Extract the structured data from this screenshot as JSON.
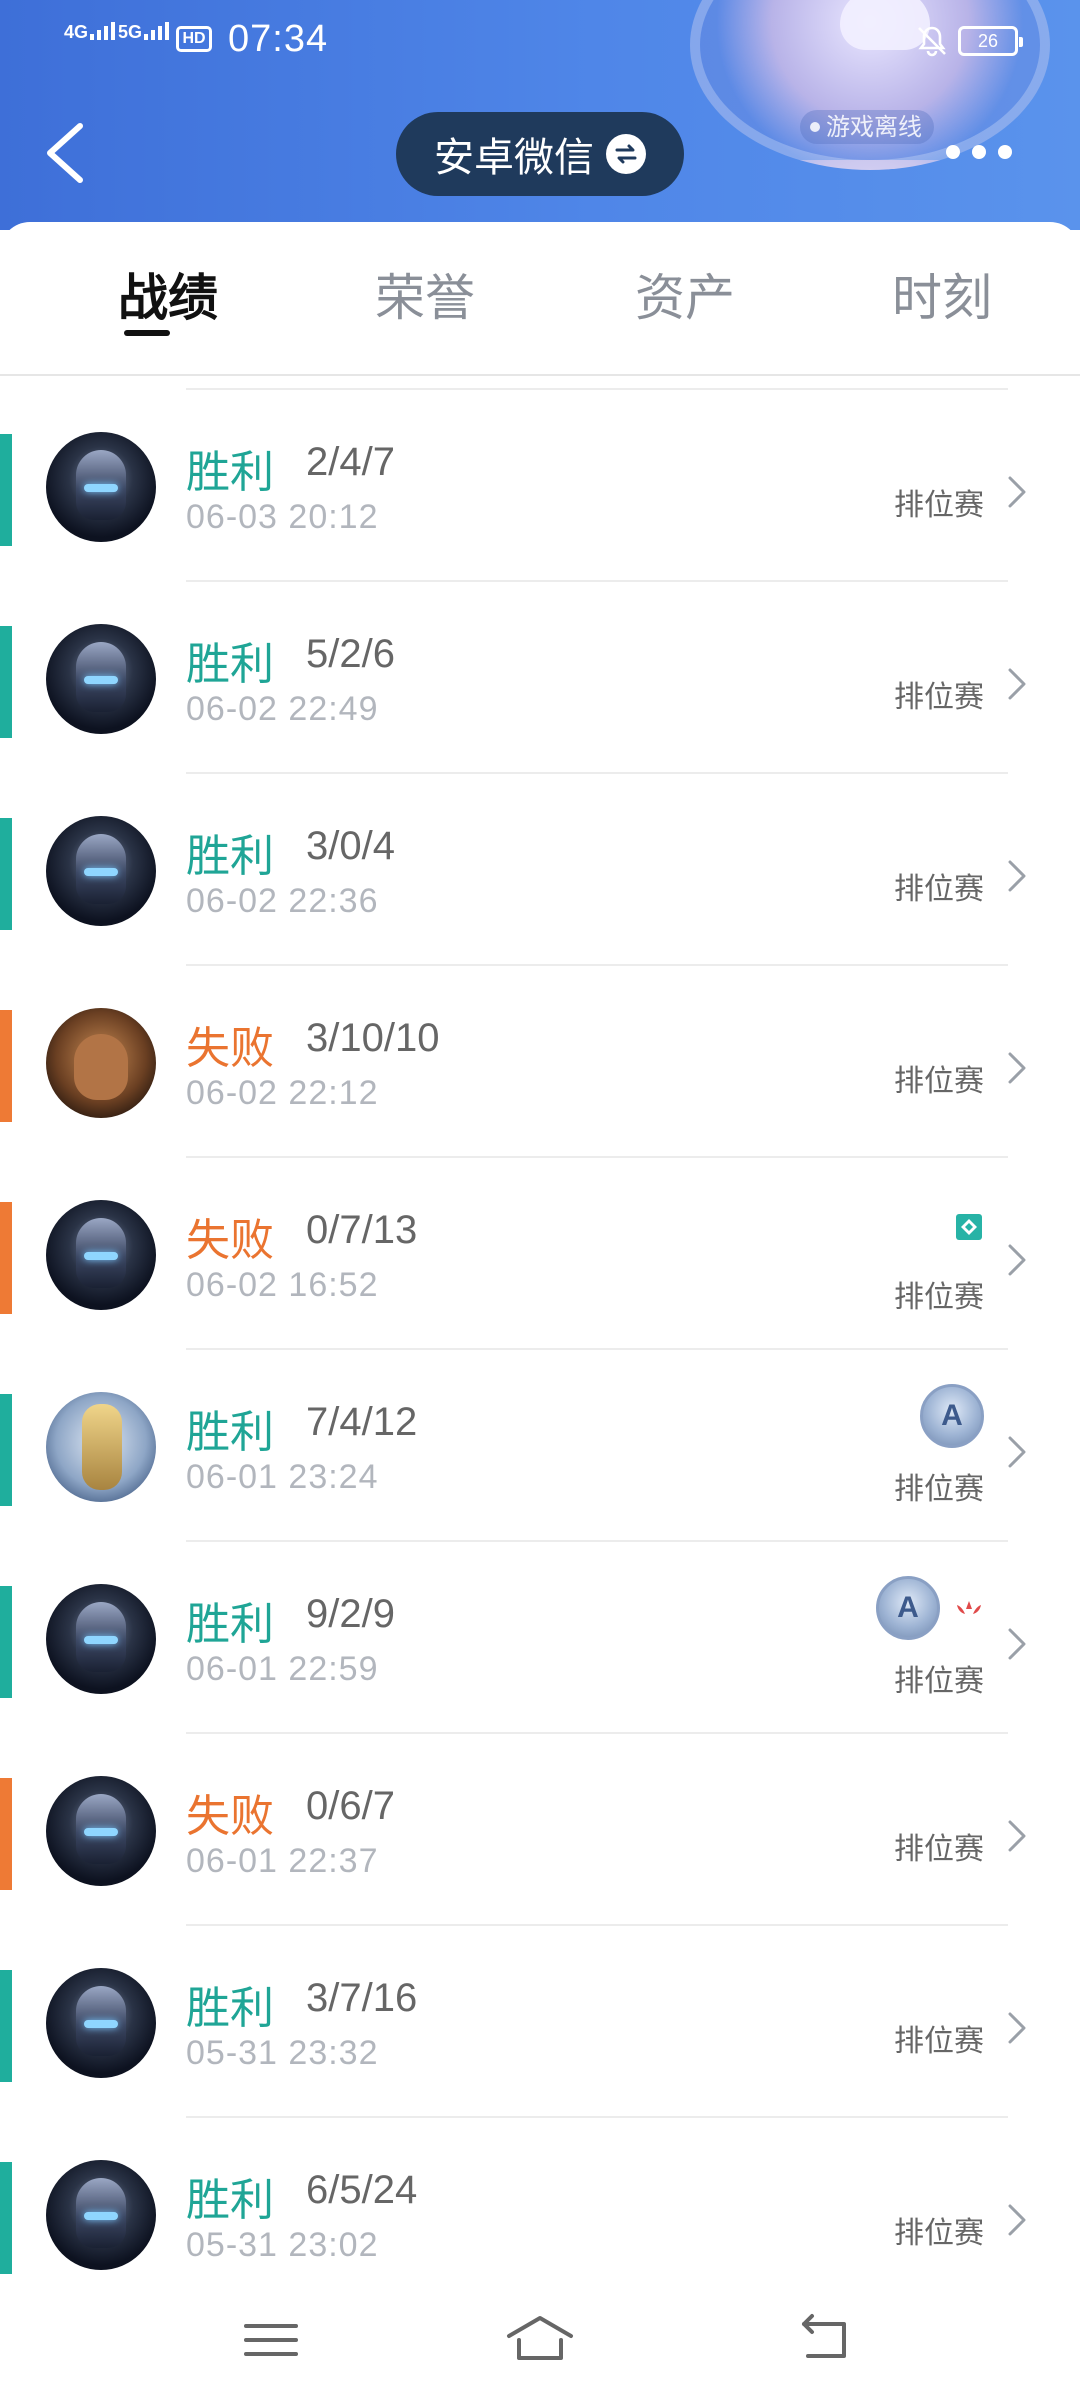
{
  "status_bar": {
    "network1": "4G",
    "network2": "5G",
    "hd": "HD",
    "time": "07:34",
    "battery": "26"
  },
  "header": {
    "account_name": "安卓微信",
    "status_text": "游戏离线"
  },
  "tabs": [
    {
      "label": "战绩",
      "active": true
    },
    {
      "label": "荣誉",
      "active": false
    },
    {
      "label": "资产",
      "active": false
    },
    {
      "label": "时刻",
      "active": false
    }
  ],
  "matches": [
    {
      "result": "胜利",
      "kda": "2/4/7",
      "time": "06-03 20:12",
      "mode": "排位赛"
    },
    {
      "result": "胜利",
      "kda": "5/2/6",
      "time": "06-02 22:49",
      "mode": "排位赛"
    },
    {
      "result": "胜利",
      "kda": "3/0/4",
      "time": "06-02 22:36",
      "mode": "排位赛"
    },
    {
      "result": "失败",
      "kda": "3/10/10",
      "time": "06-02 22:12",
      "mode": "排位赛"
    },
    {
      "result": "失败",
      "kda": "0/7/13",
      "time": "06-02 16:52",
      "mode": "排位赛"
    },
    {
      "result": "胜利",
      "kda": "7/4/12",
      "time": "06-01 23:24",
      "mode": "排位赛",
      "rank_badge": "A"
    },
    {
      "result": "胜利",
      "kda": "9/2/9",
      "time": "06-01 22:59",
      "mode": "排位赛",
      "rank_badge": "A"
    },
    {
      "result": "失败",
      "kda": "0/6/7",
      "time": "06-01 22:37",
      "mode": "排位赛"
    },
    {
      "result": "胜利",
      "kda": "3/7/16",
      "time": "05-31 23:32",
      "mode": "排位赛"
    },
    {
      "result": "胜利",
      "kda": "6/5/24",
      "time": "05-31 23:02",
      "mode": "排位赛"
    }
  ],
  "colors": {
    "win": "#1fa596",
    "loss": "#ea7430",
    "header_gradient_start": "#3e6fd8",
    "account_pill": "#1f3a5c"
  }
}
